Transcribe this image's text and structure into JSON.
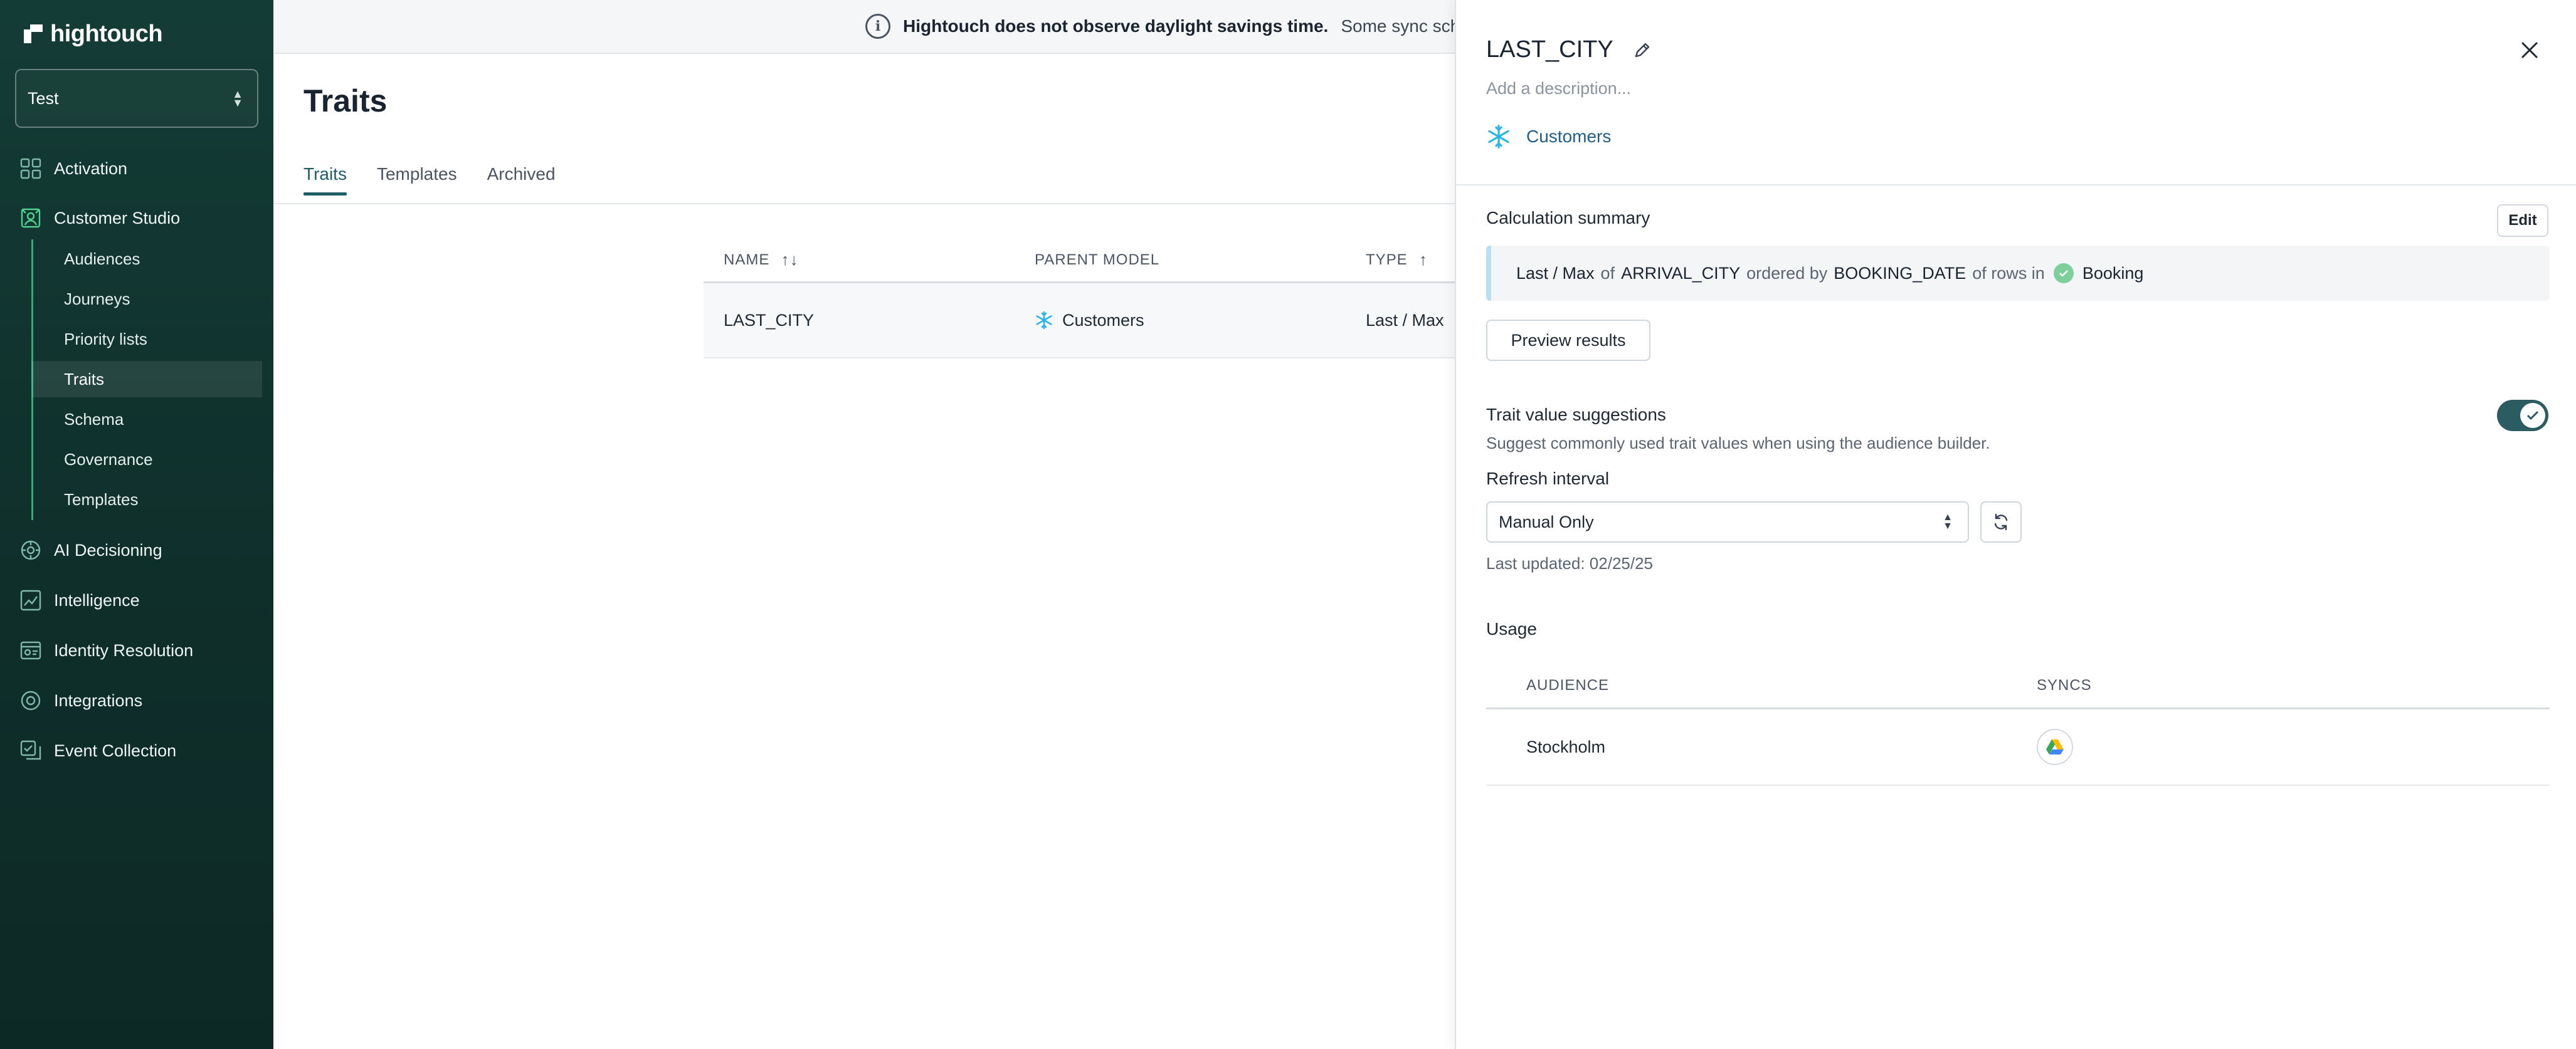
{
  "app": {
    "brand": "hightouch",
    "workspace": "Test"
  },
  "sidebar": {
    "items": [
      {
        "label": "Activation",
        "icon": "activation-icon"
      },
      {
        "label": "Customer Studio",
        "icon": "customer-studio-icon"
      },
      {
        "label": "AI Decisioning",
        "icon": "ai-decisioning-icon"
      },
      {
        "label": "Intelligence",
        "icon": "intelligence-icon"
      },
      {
        "label": "Identity Resolution",
        "icon": "identity-resolution-icon"
      },
      {
        "label": "Integrations",
        "icon": "integrations-icon"
      },
      {
        "label": "Event Collection",
        "icon": "event-collection-icon"
      }
    ],
    "subitems": [
      {
        "label": "Audiences"
      },
      {
        "label": "Journeys"
      },
      {
        "label": "Priority lists"
      },
      {
        "label": "Traits",
        "active": true
      },
      {
        "label": "Schema"
      },
      {
        "label": "Governance"
      },
      {
        "label": "Templates"
      }
    ]
  },
  "banner": {
    "bold": "Hightouch does not observe daylight savings time.",
    "rest": "Some sync schedules may be affected."
  },
  "main": {
    "title": "Traits",
    "tabs": [
      {
        "label": "Traits",
        "active": true
      },
      {
        "label": "Templates"
      },
      {
        "label": "Archived"
      }
    ],
    "table": {
      "headers": {
        "name": "NAME",
        "parent_model": "PARENT MODEL",
        "type": "TYPE"
      },
      "rows": [
        {
          "name": "LAST_CITY",
          "parent_model": "Customers",
          "type": "Last / Max"
        }
      ]
    }
  },
  "drawer": {
    "title": "LAST_CITY",
    "description_placeholder": "Add a description...",
    "model": "Customers",
    "calc_label": "Calculation summary",
    "edit_label": "Edit",
    "calc": {
      "agg": "Last / Max",
      "of1": "of",
      "column": "ARRIVAL_CITY",
      "ordered_by": "ordered by",
      "order_column": "BOOKING_DATE",
      "of_rows_in": "of rows in",
      "source": "Booking"
    },
    "preview_label": "Preview results",
    "suggestions_label": "Trait value suggestions",
    "suggestions_help": "Suggest commonly used trait values when using the audience builder.",
    "suggestions_enabled": true,
    "refresh_label": "Refresh interval",
    "refresh_value": "Manual Only",
    "last_updated": "Last updated: 02/25/25",
    "usage_label": "Usage",
    "usage": {
      "headers": {
        "audience": "AUDIENCE",
        "syncs": "SYNCS"
      },
      "rows": [
        {
          "audience": "Stockholm",
          "sync_icon": "google-drive-icon"
        }
      ]
    }
  },
  "colors": {
    "sidebar_bg": "#143c36",
    "accent": "#1e5d66",
    "link": "#1f5e8c",
    "toggle_on": "#2b5c62"
  }
}
